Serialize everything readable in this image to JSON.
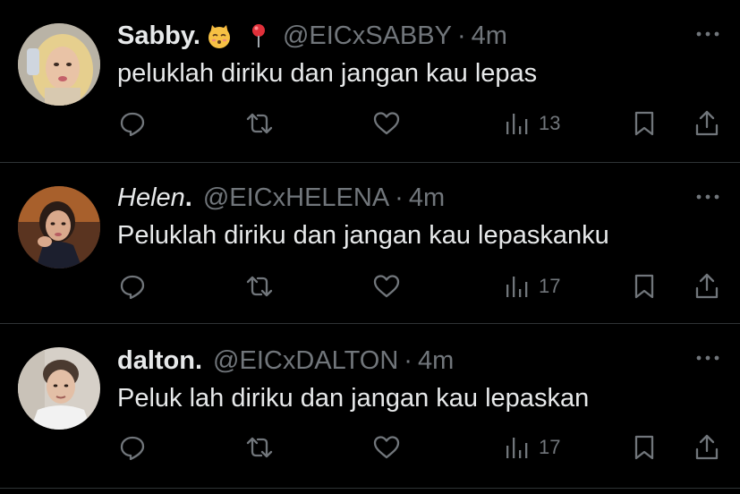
{
  "tweets": [
    {
      "name": "Sabby.",
      "handle": "@EICxSABBY",
      "separator": "·",
      "time": "4m",
      "text": "peluklah diriku dan jangan kau lepas",
      "views": "13",
      "name_emojis": [
        "kissing-cat-emoji",
        "round-pushpin-emoji"
      ]
    },
    {
      "name_italic": "Helen",
      "name_rest": ".",
      "handle": "@EICxHELENA",
      "separator": "·",
      "time": "4m",
      "text": "Peluklah diriku dan jangan kau lepaskanku",
      "views": "17"
    },
    {
      "name": "dalton.",
      "handle": "@EICxDALTON",
      "separator": "·",
      "time": "4m",
      "text": "Peluk lah diriku dan jangan kau lepaskan",
      "views": "17"
    }
  ],
  "icons": {
    "reply": "reply-icon",
    "retweet": "retweet-icon",
    "like": "heart-icon",
    "views": "views-icon",
    "bookmark": "bookmark-icon",
    "share": "share-icon",
    "more": "more-icon"
  },
  "colors": {
    "background": "#000000",
    "primary_text": "#e7e9ea",
    "secondary_text": "#71767b",
    "divider": "#2f3336"
  }
}
